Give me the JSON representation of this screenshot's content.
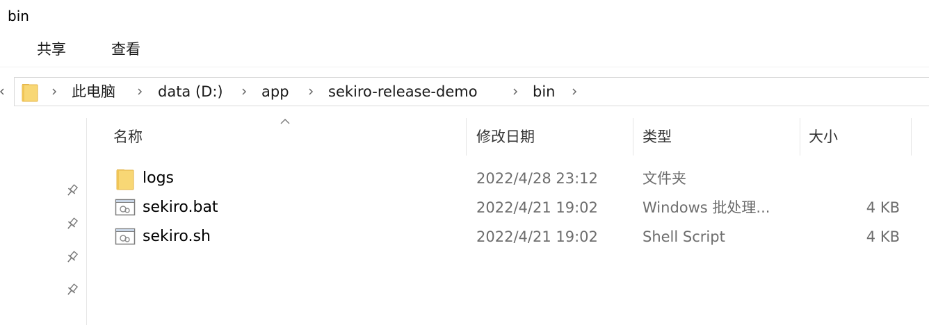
{
  "window": {
    "title": "bin"
  },
  "ribbon": {
    "tabs": [
      {
        "label": "共享"
      },
      {
        "label": "查看"
      }
    ]
  },
  "address": {
    "folder_icon": "folder-icon",
    "crumbs": [
      "此电脑",
      "data (D:)",
      "app",
      "sekiro-release-demo",
      "bin"
    ]
  },
  "columns": {
    "name": "名称",
    "modified": "修改日期",
    "type": "类型",
    "size": "大小"
  },
  "files": [
    {
      "name": "logs",
      "modified": "2022/4/28 23:12",
      "type": "文件夹",
      "size": "",
      "icon": "folder-icon"
    },
    {
      "name": "sekiro.bat",
      "modified": "2022/4/21 19:02",
      "type": "Windows 批处理...",
      "size": "4 KB",
      "icon": "script-file-icon"
    },
    {
      "name": "sekiro.sh",
      "modified": "2022/4/21 19:02",
      "type": "Shell Script",
      "size": "4 KB",
      "icon": "script-file-icon"
    }
  ],
  "colors": {
    "folder_yellow": "#f8d775",
    "folder_shadow": "#e4b54a",
    "secondary_text": "#6d6d6d",
    "divider": "#e6e6e6"
  }
}
